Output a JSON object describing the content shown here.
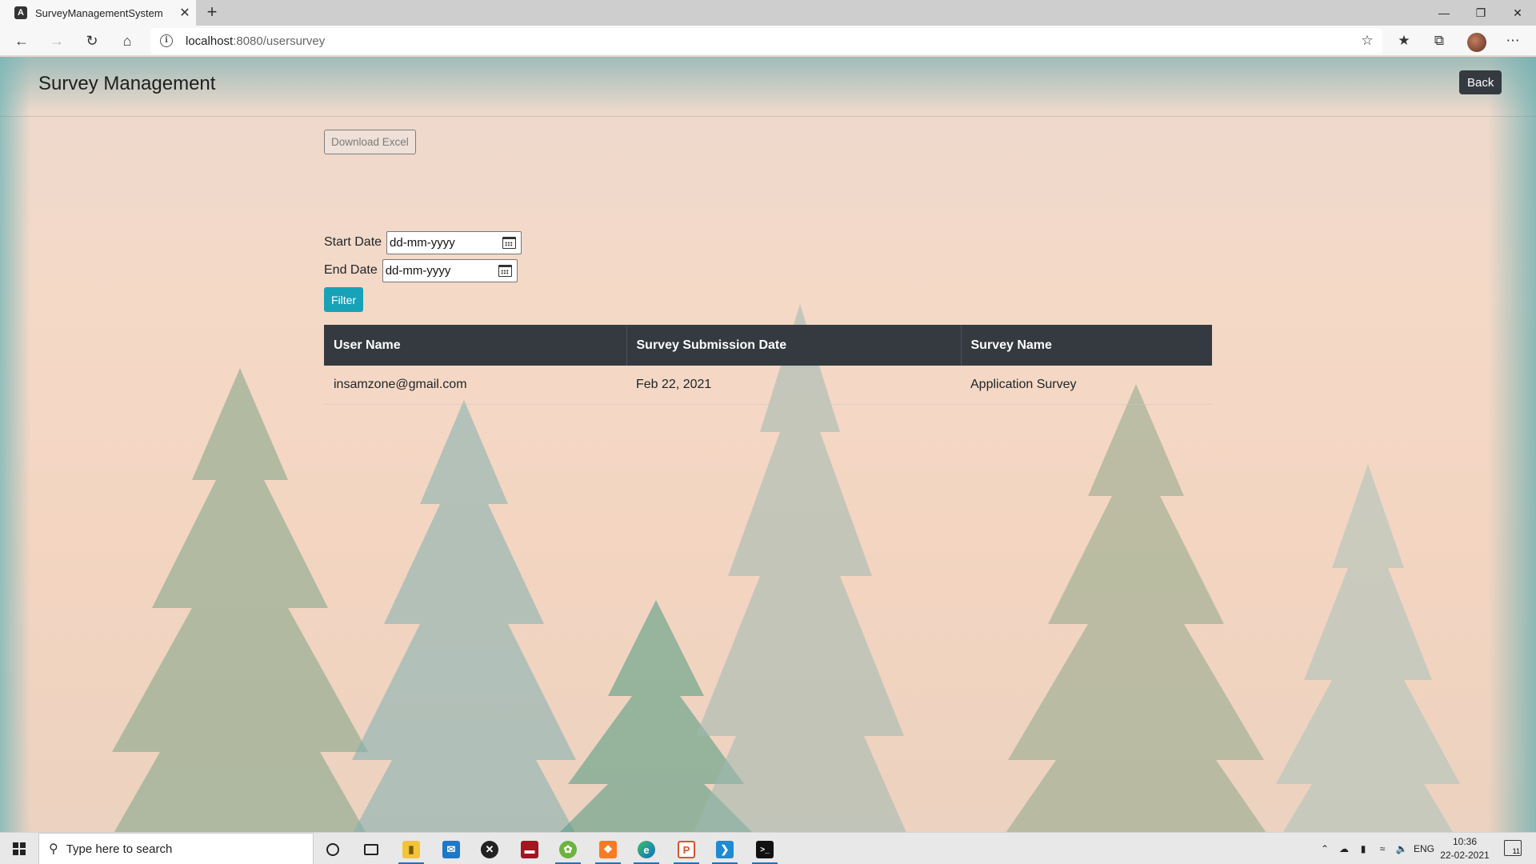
{
  "browser": {
    "tab_title": "SurveyManagementSystem",
    "tab_favicon_letter": "A",
    "url_host": "localhost",
    "url_port_path": ":8080/usersurvey"
  },
  "app": {
    "title": "Survey Management",
    "back_label": "Back",
    "download_label": "Download Excel",
    "start_date_label": "Start Date",
    "end_date_label": "End Date",
    "start_date_value": "dd-mm-yyyy",
    "end_date_value": "dd-mm-yyyy",
    "filter_label": "Filter"
  },
  "table": {
    "headers": [
      "User Name",
      "Survey Submission Date",
      "Survey Name"
    ],
    "rows": [
      [
        "insamzone@gmail.com",
        "Feb 22, 2021",
        "Application Survey"
      ]
    ]
  },
  "taskbar": {
    "search_placeholder": "Type here to search",
    "language": "ENG",
    "time": "10:36",
    "date": "22-02-2021",
    "notification_count": "11"
  },
  "colors": {
    "header_dark": "#343a40",
    "filter_teal": "#17a2b8",
    "page_peach": "#f3d5c1"
  }
}
